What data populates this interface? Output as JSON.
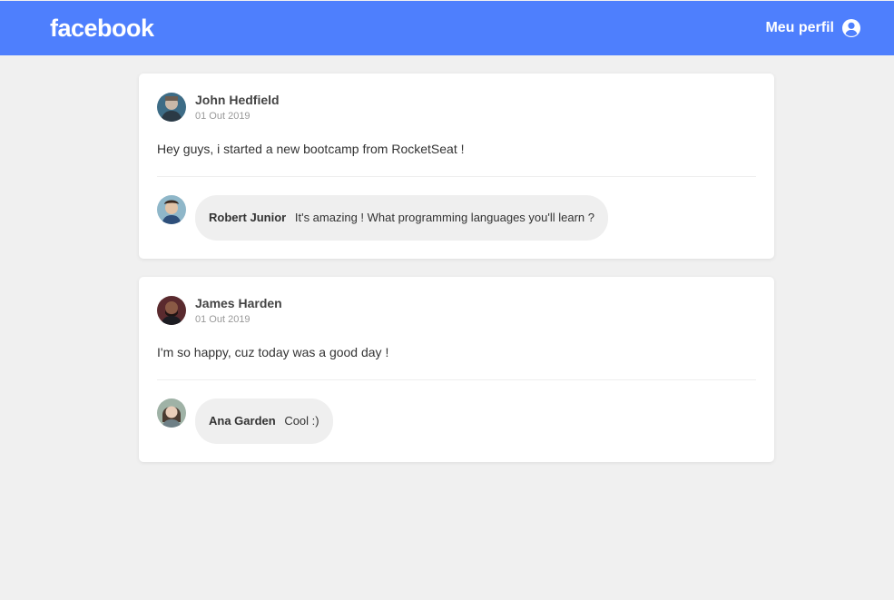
{
  "header": {
    "logo": "facebook",
    "profile_label": "Meu perfil",
    "profile_icon": "user-circle-icon",
    "background_color": "#4e7ffd"
  },
  "posts": [
    {
      "author": "John Hedfield",
      "date": "01 Out 2019",
      "content": "Hey guys, i started a new bootcamp from RocketSeat !",
      "comments": [
        {
          "author": "Robert Junior",
          "text": "It's amazing ! What programming languages you'll learn ?"
        }
      ]
    },
    {
      "author": "James Harden",
      "date": "01 Out 2019",
      "content": "I'm so happy, cuz today was a good day !",
      "comments": [
        {
          "author": "Ana Garden",
          "text": "Cool :)"
        }
      ]
    }
  ]
}
